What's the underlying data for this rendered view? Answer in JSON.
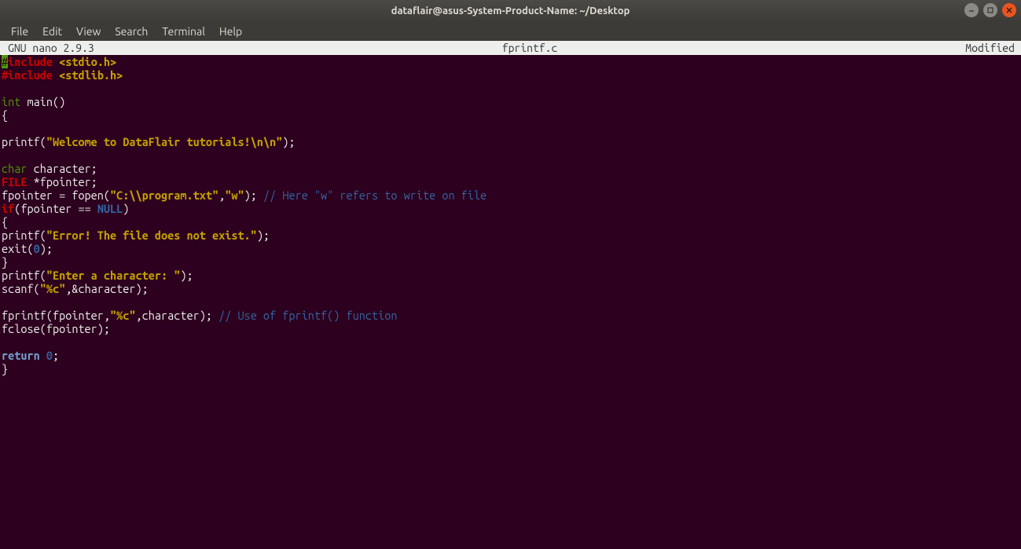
{
  "window": {
    "title": "dataflair@asus-System-Product-Name: ~/Desktop"
  },
  "menubar": {
    "items": [
      "File",
      "Edit",
      "View",
      "Search",
      "Terminal",
      "Help"
    ]
  },
  "nano": {
    "app": "GNU nano 2.9.3",
    "filename": "fprintf.c",
    "status": "Modified"
  },
  "code": {
    "lines": [
      [
        {
          "t": "#",
          "c": "cursor-bg"
        },
        {
          "t": "include ",
          "c": "kw-red"
        },
        {
          "t": "<stdio.h>",
          "c": "str"
        }
      ],
      [
        {
          "t": "#include ",
          "c": "kw-red"
        },
        {
          "t": "<stdlib.h>",
          "c": "str"
        }
      ],
      [],
      [
        {
          "t": "int",
          "c": "kw-type"
        },
        {
          "t": " main()"
        }
      ],
      [
        {
          "t": "{"
        }
      ],
      [],
      [
        {
          "t": "printf("
        },
        {
          "t": "\"Welcome to DataFlair tutorials!\\n\\n\"",
          "c": "str"
        },
        {
          "t": ");"
        }
      ],
      [],
      [
        {
          "t": "char",
          "c": "kw-type"
        },
        {
          "t": " character;"
        }
      ],
      [
        {
          "t": "FILE",
          "c": "kw-red"
        },
        {
          "t": " *fpointer;"
        }
      ],
      [
        {
          "t": "fpointer = fopen("
        },
        {
          "t": "\"C:\\\\program.txt\"",
          "c": "str"
        },
        {
          "t": ","
        },
        {
          "t": "\"w\"",
          "c": "str"
        },
        {
          "t": "); "
        },
        {
          "t": "// Here \"w\" refers to write on file",
          "c": "comment"
        }
      ],
      [
        {
          "t": "if",
          "c": "kw-red"
        },
        {
          "t": "(fpointer == "
        },
        {
          "t": "NULL",
          "c": "null"
        },
        {
          "t": ")"
        }
      ],
      [
        {
          "t": "{"
        }
      ],
      [
        {
          "t": "printf("
        },
        {
          "t": "\"Error! The file does not exist.\"",
          "c": "str"
        },
        {
          "t": ");"
        }
      ],
      [
        {
          "t": "exit("
        },
        {
          "t": "0",
          "c": "num"
        },
        {
          "t": ");"
        }
      ],
      [
        {
          "t": "}"
        }
      ],
      [
        {
          "t": "printf("
        },
        {
          "t": "\"Enter a character: \"",
          "c": "str"
        },
        {
          "t": ");"
        }
      ],
      [
        {
          "t": "scanf("
        },
        {
          "t": "\"%c\"",
          "c": "str"
        },
        {
          "t": ",&character);"
        }
      ],
      [],
      [
        {
          "t": "fprintf(fpointer,"
        },
        {
          "t": "\"%c\"",
          "c": "str"
        },
        {
          "t": ",character); "
        },
        {
          "t": "// Use of fprintf() function",
          "c": "comment"
        }
      ],
      [
        {
          "t": "fclose(fpointer);"
        }
      ],
      [],
      [
        {
          "t": "return ",
          "c": "arrow"
        },
        {
          "t": "0",
          "c": "num"
        },
        {
          "t": ";"
        }
      ],
      [
        {
          "t": "}"
        }
      ]
    ]
  }
}
